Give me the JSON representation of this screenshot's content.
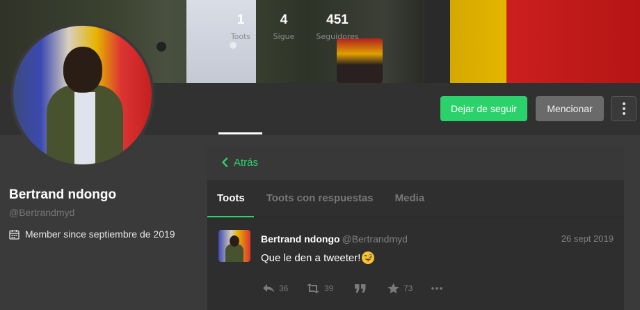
{
  "profile": {
    "display_name": "Bertrand ndongo",
    "handle": "@Bertrandmyd",
    "member_since": "Member since septiembre de 2019"
  },
  "stats": [
    {
      "value": "1",
      "label": "Toots"
    },
    {
      "value": "4",
      "label": "Sigue"
    },
    {
      "value": "451",
      "label": "Seguidores"
    }
  ],
  "buttons": {
    "unfollow": "Dejar de seguir",
    "mention": "Mencionar"
  },
  "column": {
    "back_label": "Atrás",
    "tabs": [
      "Toots",
      "Toots con respuestas",
      "Media"
    ]
  },
  "status": {
    "name": "Bertrand ndongo",
    "acct": "@Bertrandmyd",
    "date": "26 sept 2019",
    "text": "Que le den a tweeter!",
    "emoji": "winking-face-tongue",
    "replies": "36",
    "reblogs": "39",
    "favourites": "73"
  },
  "colors": {
    "accent": "#2bd26b",
    "background": "#3a3a3a"
  }
}
